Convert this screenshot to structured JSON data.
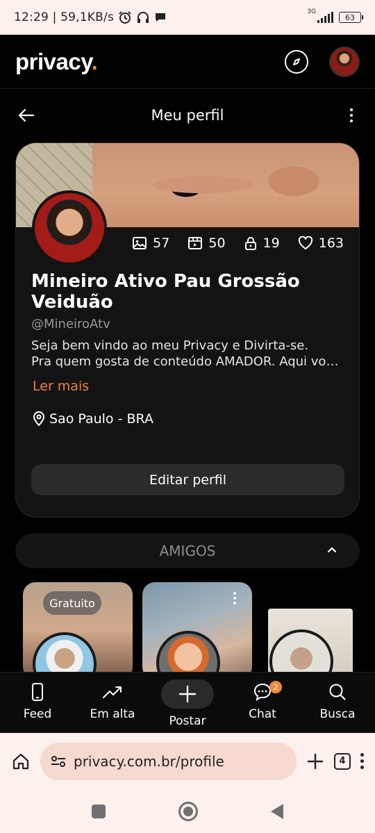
{
  "status_bar": {
    "time": "12:29",
    "separator": "|",
    "speed": "59,1KB/s",
    "network": "3G",
    "battery": "63"
  },
  "app_header": {
    "logo": "privacy",
    "logo_dot": ".",
    "accent_color": "#f08a3a"
  },
  "page": {
    "title": "Meu perfil"
  },
  "profile": {
    "stats": {
      "photos": "57",
      "videos": "50",
      "locked": "19",
      "likes": "163"
    },
    "name": "Mineiro Ativo Pau Grossão Veiduão",
    "handle": "@MineiroAtv",
    "bio_line1": "Seja bem vindo ao meu Privacy e Divirta-se.",
    "bio_line2": "Pra quem gosta de conteúdo AMADOR. Aqui voce vai encontrar",
    "read_more": "Ler mais",
    "location": "Sao Paulo - BRA",
    "edit_button": "Editar perfil"
  },
  "friends": {
    "header": "AMIGOS",
    "free_badge": "Gratuito"
  },
  "tabbar": {
    "feed": "Feed",
    "trending": "Em alta",
    "post": "Postar",
    "chat": "Chat",
    "chat_badge": "2",
    "search": "Busca"
  },
  "browser": {
    "url": "privacy.com.br/profile",
    "tab_count": "4"
  }
}
